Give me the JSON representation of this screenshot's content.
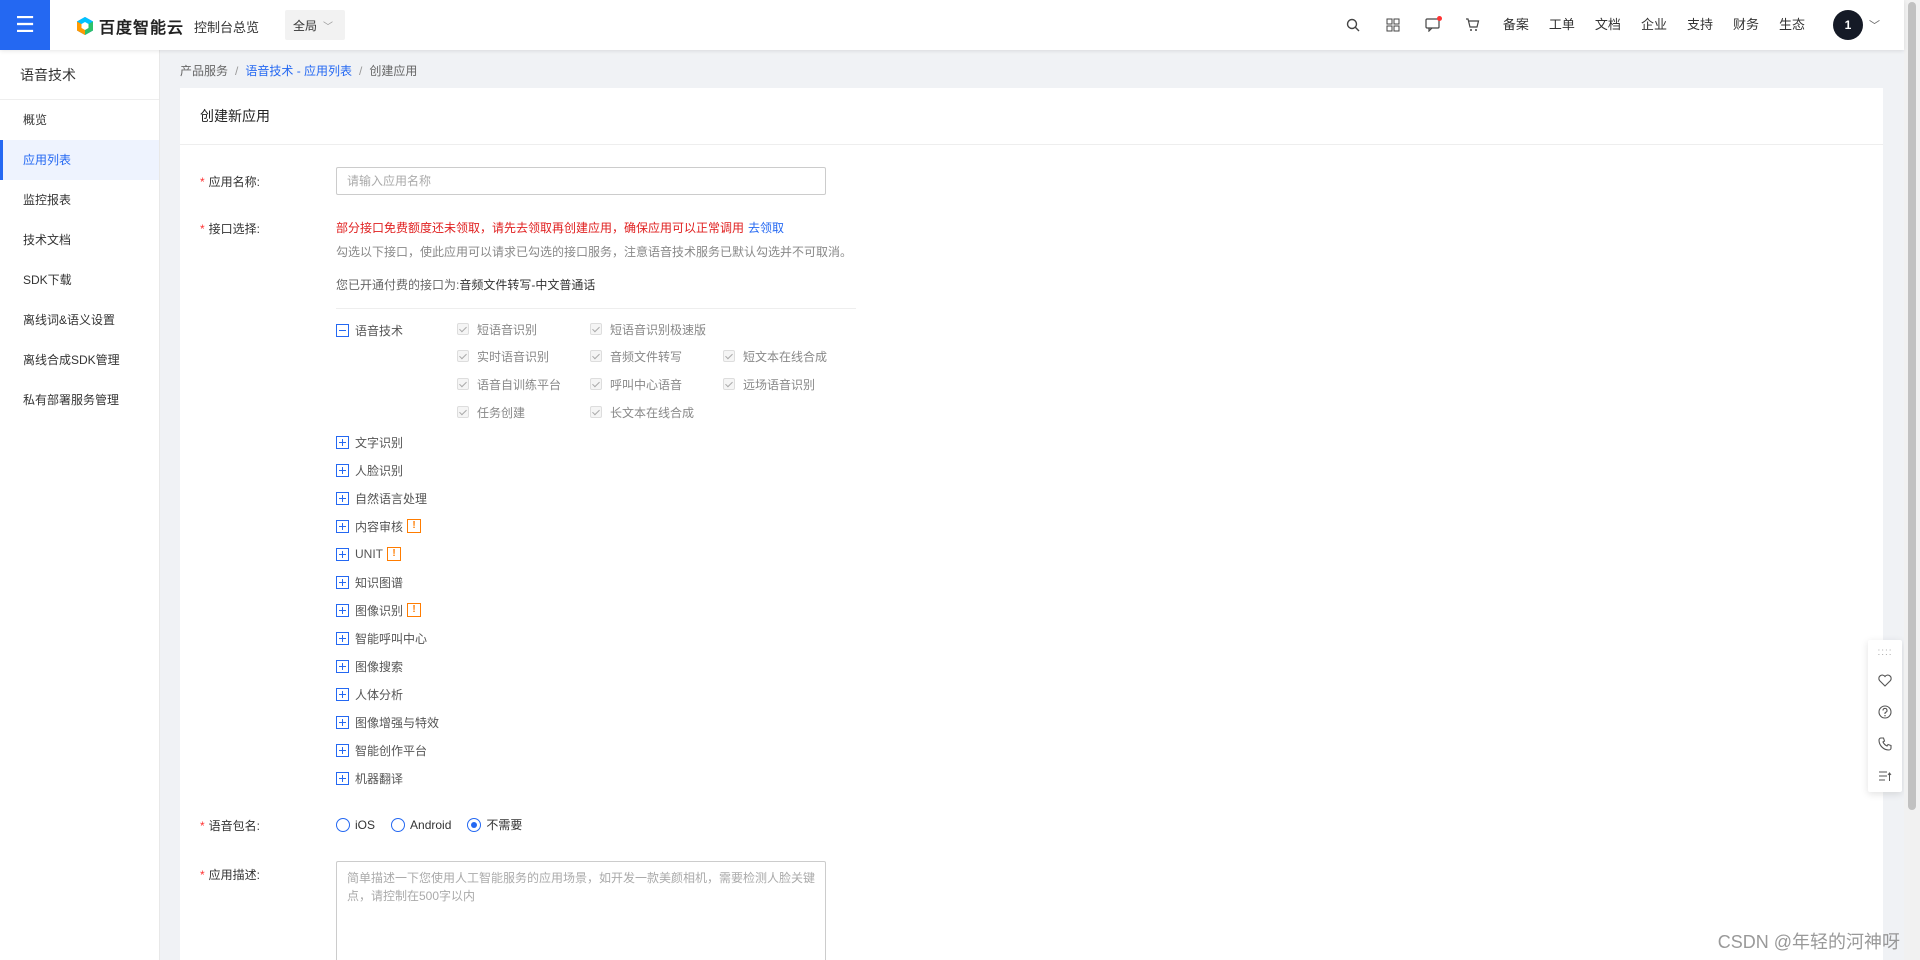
{
  "topbar": {
    "menu_icon": "hamburger-icon",
    "logo_text": "百度智能云",
    "console_label": "控制台总览",
    "region_value": "全局",
    "icons": [
      "search-icon",
      "apps-icon",
      "message-icon",
      "cart-icon"
    ],
    "links": [
      "备案",
      "工单",
      "文档",
      "企业",
      "支持",
      "财务",
      "生态"
    ],
    "avatar_text": "1"
  },
  "sidebar": {
    "title": "语音技术",
    "items": [
      {
        "label": "概览",
        "active": false
      },
      {
        "label": "应用列表",
        "active": true
      },
      {
        "label": "监控报表",
        "active": false
      },
      {
        "label": "技术文档",
        "active": false
      },
      {
        "label": "SDK下载",
        "active": false
      },
      {
        "label": "离线词&语义设置",
        "active": false
      },
      {
        "label": "离线合成SDK管理",
        "active": false
      },
      {
        "label": "私有部署服务管理",
        "active": false
      }
    ]
  },
  "breadcrumb": {
    "root": "产品服务",
    "parent": "语音技术 - 应用列表",
    "current": "创建应用",
    "sep": "/"
  },
  "form": {
    "card_title": "创建新应用",
    "name_label": "应用名称:",
    "name_placeholder": "请输入应用名称",
    "name_value": "",
    "api_label": "接口选择:",
    "warning_text": "部分接口免费额度还未领取，请先去领取再创建应用，确保应用可以正常调用",
    "warning_link": "去领取",
    "hint_text": "勾选以下接口，使此应用可以请求已勾选的接口服务，注意语音技术服务已默认勾选并不可取消。",
    "paid_prefix": "您已开通付费的接口为:",
    "paid_value": "音频文件转写-中文普通话",
    "required_mark": "*",
    "expanded_category": "语音技术",
    "speech_apis": [
      "短语音识别",
      "短语音识别极速版",
      "实时语音识别",
      "音频文件转写",
      "短文本在线合成",
      "语音自训练平台",
      "呼叫中心语音",
      "远场语音识别",
      "任务创建",
      "长文本在线合成"
    ],
    "categories": [
      {
        "label": "文字识别",
        "badge": false
      },
      {
        "label": "人脸识别",
        "badge": false
      },
      {
        "label": "自然语言处理",
        "badge": false
      },
      {
        "label": "内容审核",
        "badge": true
      },
      {
        "label": "UNIT",
        "badge": true
      },
      {
        "label": "知识图谱",
        "badge": false
      },
      {
        "label": "图像识别",
        "badge": true
      },
      {
        "label": "智能呼叫中心",
        "badge": false
      },
      {
        "label": "图像搜索",
        "badge": false
      },
      {
        "label": "人体分析",
        "badge": false
      },
      {
        "label": "图像增强与特效",
        "badge": false
      },
      {
        "label": "智能创作平台",
        "badge": false
      },
      {
        "label": "机器翻译",
        "badge": false
      }
    ],
    "badge_glyph": "!",
    "package_label": "语音包名:",
    "package_options": [
      "iOS",
      "Android",
      "不需要"
    ],
    "package_selected": "不需要",
    "desc_label": "应用描述:",
    "desc_placeholder": "简单描述一下您使用人工智能服务的应用场景，如开发一款美颜相机，需要检测人脸关键点，请控制在500字以内",
    "desc_value": ""
  },
  "float_panel": {
    "icons": [
      "drag-grip-icon",
      "heart-icon",
      "help-icon",
      "phone-icon",
      "list-icon"
    ]
  },
  "watermark": "CSDN @年轻的河神呀",
  "colors": {
    "accent": "#2468f2",
    "warning": "#e02020",
    "badge": "#ff7c00"
  }
}
